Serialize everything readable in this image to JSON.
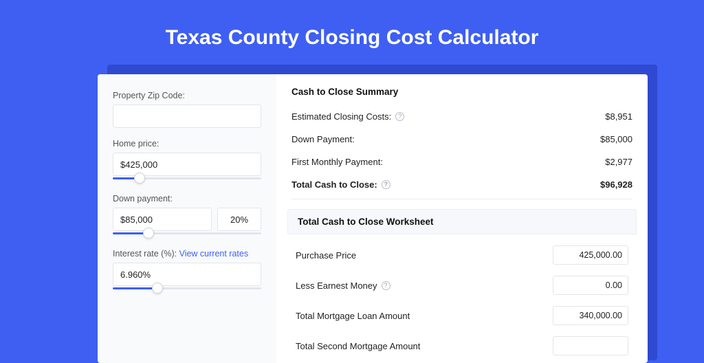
{
  "page": {
    "title": "Texas County Closing Cost Calculator"
  },
  "inputs": {
    "zip": {
      "label": "Property Zip Code:",
      "value": ""
    },
    "home_price": {
      "label": "Home price:",
      "value": "$425,000",
      "slider_pct": 18
    },
    "down_pay": {
      "label": "Down payment:",
      "value": "$85,000",
      "pct": "20%",
      "slider_pct": 24
    },
    "interest": {
      "label": "Interest rate (%):",
      "link": "View current rates",
      "value": "6.960%",
      "slider_pct": 30
    }
  },
  "summary": {
    "title": "Cash to Close Summary",
    "rows": [
      {
        "label": "Estimated Closing Costs:",
        "help": true,
        "value": "$8,951"
      },
      {
        "label": "Down Payment:",
        "help": false,
        "value": "$85,000"
      },
      {
        "label": "First Monthly Payment:",
        "help": false,
        "value": "$2,977"
      }
    ],
    "total": {
      "label": "Total Cash to Close:",
      "help": true,
      "value": "$96,928"
    }
  },
  "worksheet": {
    "title": "Total Cash to Close Worksheet",
    "rows": [
      {
        "label": "Purchase Price",
        "help": false,
        "value": "425,000.00"
      },
      {
        "label": "Less Earnest Money",
        "help": true,
        "value": "0.00"
      },
      {
        "label": "Total Mortgage Loan Amount",
        "help": false,
        "value": "340,000.00"
      },
      {
        "label": "Total Second Mortgage Amount",
        "help": false,
        "value": ""
      }
    ]
  }
}
